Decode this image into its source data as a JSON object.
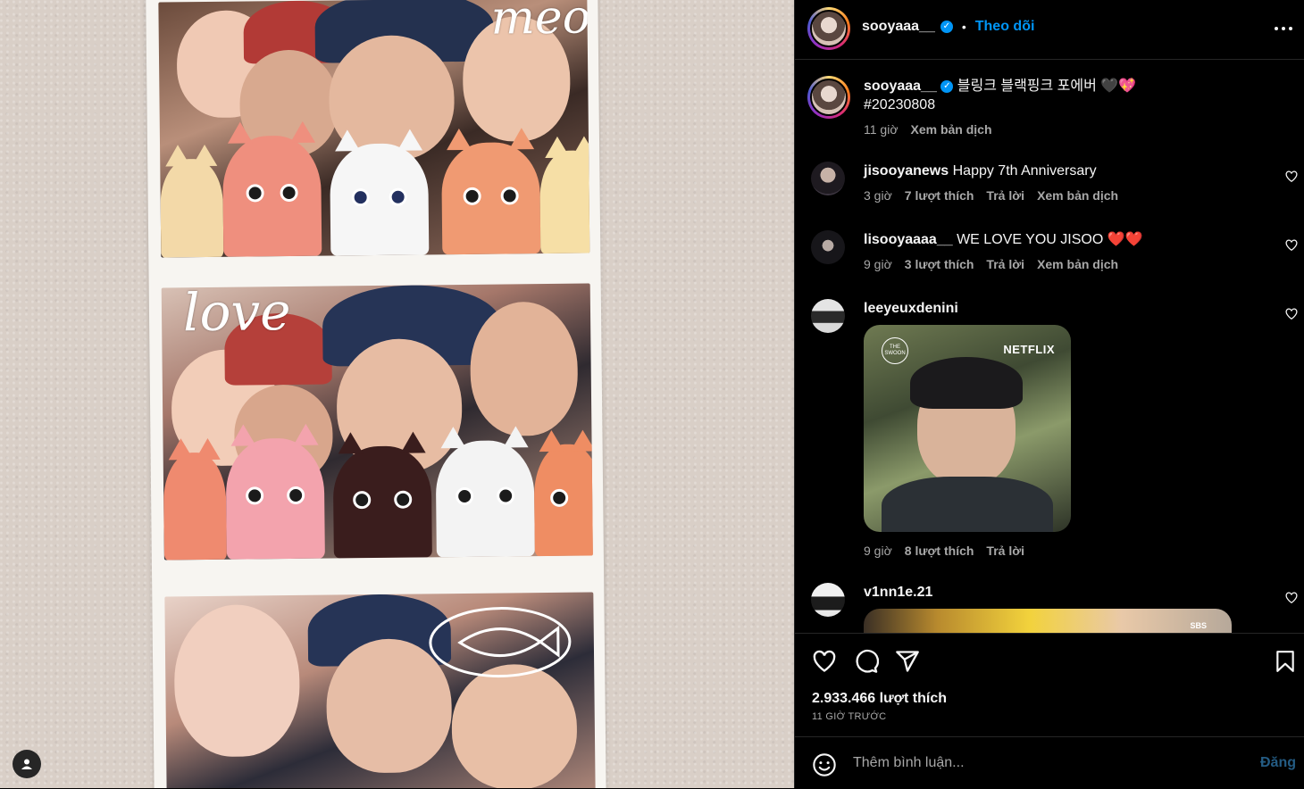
{
  "post": {
    "author": "sooyaaa__",
    "follow_label": "Theo dõi",
    "more_icon": "more-horizontal-icon",
    "caption_text": "블링크 블랙핑크 포에버 🖤💖",
    "caption_hashtag": "#20230808",
    "caption_time": "11 giờ",
    "caption_translate": "Xem bản dịch",
    "photo_doodle_meow": "meow",
    "photo_doodle_love": "love"
  },
  "comments": [
    {
      "username": "jisooyanews",
      "text": "Happy 7th Anniversary",
      "time": "3 giờ",
      "likes": "7 lượt thích",
      "reply": "Trả lời",
      "translate": "Xem bản dịch"
    },
    {
      "username": "lisooyaaaa__",
      "text": "WE LOVE YOU JISOO ❤️❤️",
      "time": "9 giờ",
      "likes": "3 lượt thích",
      "reply": "Trả lời",
      "translate": "Xem bản dịch"
    },
    {
      "username": "leeyeuxdenini",
      "text": "",
      "time": "9 giờ",
      "likes": "8 lượt thích",
      "reply": "Trả lời",
      "image_brand": "NETFLIX",
      "image_logo": "THE SWOON"
    },
    {
      "username": "v1nn1e.21",
      "text": "",
      "image_caption": "SBS"
    }
  ],
  "footer": {
    "likes_count": "2.933.466 lượt thích",
    "posted_ago": "11 GIỜ TRƯỚC",
    "add_comment_placeholder": "Thêm bình luận...",
    "post_button": "Đăng"
  },
  "colors": {
    "accent": "#0095f6",
    "background": "#000000",
    "muted": "#a8a8a8",
    "divider": "#262626"
  }
}
